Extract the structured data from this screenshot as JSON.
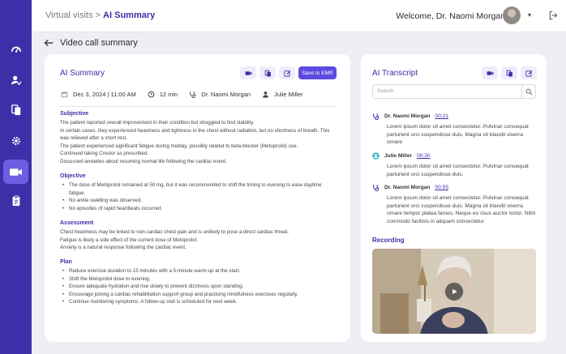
{
  "header": {
    "breadcrumb_parent": "Virtual visits",
    "breadcrumb_sep": ">",
    "breadcrumb_current": "AI Summary",
    "welcome": "Welcome, Dr. Naomi Morgan"
  },
  "page": {
    "title": "Video call summary"
  },
  "sidebar": {
    "items": [
      {
        "icon": "dashboard-gauge-icon"
      },
      {
        "icon": "patient-check-icon"
      },
      {
        "icon": "documents-icon"
      },
      {
        "icon": "settings-icon"
      },
      {
        "icon": "video-camera-icon",
        "active": true
      },
      {
        "icon": "clipboard-icon"
      }
    ]
  },
  "summary": {
    "title": "AI Summary",
    "save_label": "Save to EMR",
    "date": "Dec 3, 2024 | 11:00 AM",
    "duration": "12 min",
    "doctor": "Dr. Naomi Morgan",
    "patient": "Julie Miller",
    "subjective_title": "Subjective",
    "subjective_lines": [
      "The patient reported overall improvement in their condition but struggled to find stability.",
      "In certain cases, they experienced heaviness and tightness in the chest without radiation, but no shortness of breath. This was relieved after a short rest.",
      "The patient experienced significant fatigue during midday, possibly related to beta-blocker (Metoprolol) use.",
      "Continued taking Crestor as prescribed.",
      "Discussed anxieties about resuming normal life following the cardiac event."
    ],
    "objective_title": "Objective",
    "objective_items": [
      "The dose of Metoprolol remained at 50 mg, but it was recommended to shift the timing to evening to ease daytime fatigue.",
      "No ankle swelling was observed.",
      "No episodes of rapid heartbeats occurred."
    ],
    "assessment_title": "Assessment",
    "assessment_lines": [
      "Chest heaviness may be linked to non-cardiac chest pain and is unlikely to pose a direct cardiac threat.",
      "Fatigue is likely a side effect of the current dose of Metoprolol.",
      "Anxiety is a natural response following the cardiac event."
    ],
    "plan_title": "Plan",
    "plan_items": [
      "Reduce exercise duration to 15 minutes with a 5-minute warm-up at the start.",
      "Shift the Metoprolol dose to evening.",
      "Ensure adequate hydration and rise slowly to prevent dizziness upon standing.",
      "Encourage joining a cardiac rehabilitation support group and practicing mindfulness exercises regularly.",
      "Continue monitoring symptoms. A follow-up visit is scheduled for next week."
    ]
  },
  "transcript": {
    "title": "AI Transcript",
    "search_placeholder": "Search",
    "messages": [
      {
        "speaker": "Dr. Naomi Morgan",
        "time": "00:21",
        "text": "Lorem ipsum dolor sit amet consectetur. Pulvinar consequat parturient orci suspendisse duis. Magna sit blandit viverra ornare"
      },
      {
        "speaker": "Julie Miller",
        "time": "00:30",
        "text": "Lorem ipsum dolor sit amet consectetur. Pulvinar consequat parturient orci suspendisse duis."
      },
      {
        "speaker": "Dr. Naomi Morgan",
        "time": "00:55",
        "text": "Lorem ipsum dolor sit amet consectetur. Pulvinar consequat parturient orci suspendisse duis. Magna sit blandit viverra ornare tempor platea fames. Neque eu risus auctor tortor. Nibh commodo facilisis in aliquam consectetur"
      }
    ],
    "recording_title": "Recording"
  },
  "colors": {
    "accent": "#3d2fa8",
    "button": "#5b4be0",
    "sidebar_active": "#6c5ee0"
  }
}
